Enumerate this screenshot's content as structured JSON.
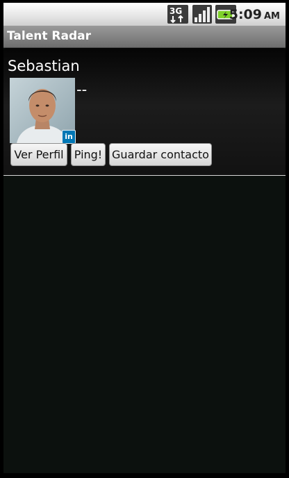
{
  "status_bar": {
    "network_label": "3G",
    "time": "5:09",
    "ampm": "AM",
    "icons": [
      "network-3g-icon",
      "signal-icon",
      "battery-icon"
    ]
  },
  "app": {
    "title": "Talent Radar"
  },
  "profile": {
    "name": "Sebastian",
    "headline": "--",
    "badge_text": "in",
    "buttons": {
      "view_profile": "Ver Perfil",
      "ping": "Ping!",
      "save_contact": "Guardar contacto"
    }
  },
  "colors": {
    "background": "#0c110e",
    "linkedin_blue": "#0077b5",
    "titlebar": "#7a7a7a"
  }
}
